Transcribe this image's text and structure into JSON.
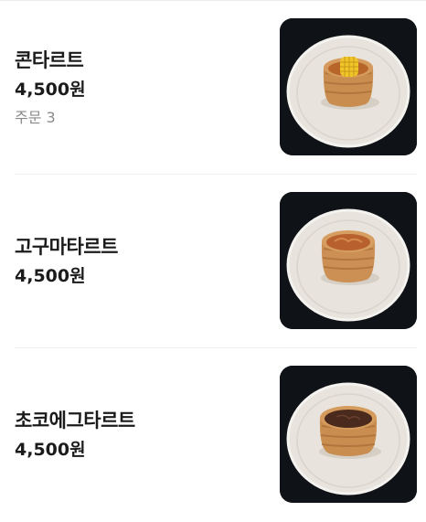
{
  "menu": {
    "items": [
      {
        "name": "콘타르트",
        "price": "4,500원",
        "orders": "주문 3",
        "image": "corn-tart-photo",
        "filling_color": "#c7792a",
        "topping": "corn"
      },
      {
        "name": "고구마타르트",
        "price": "4,500원",
        "image": "sweet-potato-tart-photo",
        "filling_color": "#c0703a",
        "topping": "sweet-potato"
      },
      {
        "name": "초코에그타르트",
        "price": "4,500원",
        "image": "chocolate-egg-tart-photo",
        "filling_color": "#4a2a1c",
        "topping": "chocolate"
      }
    ]
  }
}
